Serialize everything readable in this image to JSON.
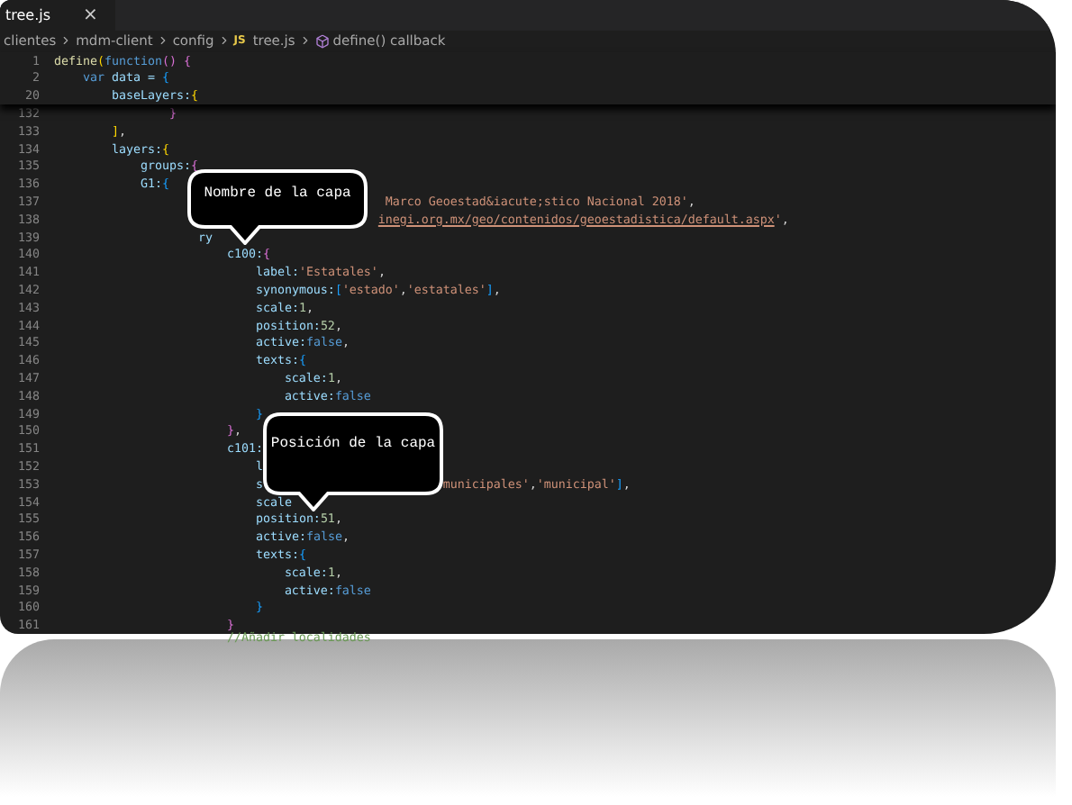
{
  "tab": {
    "label": "tree.js",
    "close": "×",
    "selected": true
  },
  "breadcrumb": [
    {
      "kind": "folder",
      "text": "clientes"
    },
    {
      "kind": "folder",
      "text": "mdm-client"
    },
    {
      "kind": "folder",
      "text": "config"
    },
    {
      "kind": "file",
      "badge": "JS",
      "text": "tree.js"
    },
    {
      "kind": "symbol",
      "text": "define() callback"
    }
  ],
  "sticky_lines": [
    {
      "number": "1",
      "tokens": [
        {
          "kind": "fn",
          "text": "define"
        },
        {
          "kind": "b1",
          "text": "("
        },
        {
          "kind": "kw",
          "text": "function"
        },
        {
          "kind": "b2",
          "text": "()"
        },
        {
          "kind": "b2",
          "text": " {"
        }
      ]
    },
    {
      "number": "2",
      "tokens": [
        {
          "kind": "kw",
          "text": "    var"
        },
        {
          "kind": "prop",
          "text": " data = "
        },
        {
          "kind": "b3",
          "text": "{"
        }
      ]
    },
    {
      "number": "20",
      "tokens": [
        {
          "kind": "prop",
          "text": "        baseLayers:"
        },
        {
          "kind": "b1",
          "text": "{"
        }
      ]
    }
  ],
  "lines": [
    {
      "number": "132",
      "tokens": [
        {
          "kind": "b2",
          "text": "                }"
        }
      ]
    },
    {
      "number": "133",
      "tokens": [
        {
          "kind": "b1",
          "text": "        ]"
        },
        {
          "kind": "punc",
          "text": ","
        }
      ]
    },
    {
      "number": "134",
      "tokens": [
        {
          "kind": "prop",
          "text": "        layers:"
        },
        {
          "kind": "b1",
          "text": "{"
        }
      ]
    },
    {
      "number": "135",
      "tokens": [
        {
          "kind": "prop",
          "text": "            groups:"
        },
        {
          "kind": "b2",
          "text": "{"
        }
      ]
    },
    {
      "number": "136",
      "tokens": [
        {
          "kind": "prop",
          "text": "            G1:"
        },
        {
          "kind": "b3",
          "text": "{"
        }
      ]
    },
    {
      "number": "137",
      "tokens": [
        {
          "kind": "str",
          "text": "                                              Marco Geoestad&iacute;stico Nacional 2018'"
        },
        {
          "kind": "punc",
          "text": ","
        }
      ]
    },
    {
      "number": "138",
      "tokens": [
        {
          "kind": "link",
          "text": "                                             inegi.org.mx/geo/contenidos/geoestadistica/default.aspx"
        },
        {
          "kind": "str",
          "text": "'"
        },
        {
          "kind": "punc",
          "text": ","
        }
      ]
    },
    {
      "number": "139",
      "tokens": [
        {
          "kind": "prop",
          "text": "                    ry"
        }
      ]
    },
    {
      "number": "140",
      "tokens": [
        {
          "kind": "prop",
          "text": "                        c100:"
        },
        {
          "kind": "b2",
          "text": "{"
        }
      ]
    },
    {
      "number": "141",
      "tokens": [
        {
          "kind": "prop",
          "text": "                            label:"
        },
        {
          "kind": "str",
          "text": "'Estatales'"
        },
        {
          "kind": "punc",
          "text": ","
        }
      ]
    },
    {
      "number": "142",
      "tokens": [
        {
          "kind": "prop",
          "text": "                            synonymous:"
        },
        {
          "kind": "b3",
          "text": "["
        },
        {
          "kind": "str",
          "text": "'estado'"
        },
        {
          "kind": "punc",
          "text": ","
        },
        {
          "kind": "str",
          "text": "'estatales'"
        },
        {
          "kind": "b3",
          "text": "]"
        },
        {
          "kind": "punc",
          "text": ","
        }
      ]
    },
    {
      "number": "143",
      "tokens": [
        {
          "kind": "prop",
          "text": "                            scale:"
        },
        {
          "kind": "num",
          "text": "1"
        },
        {
          "kind": "punc",
          "text": ","
        }
      ]
    },
    {
      "number": "144",
      "tokens": [
        {
          "kind": "prop",
          "text": "                            position:"
        },
        {
          "kind": "num",
          "text": "52"
        },
        {
          "kind": "punc",
          "text": ","
        }
      ]
    },
    {
      "number": "145",
      "tokens": [
        {
          "kind": "prop",
          "text": "                            active:"
        },
        {
          "kind": "kw",
          "text": "false"
        },
        {
          "kind": "punc",
          "text": ","
        }
      ]
    },
    {
      "number": "146",
      "tokens": [
        {
          "kind": "prop",
          "text": "                            texts:"
        },
        {
          "kind": "b3",
          "text": "{"
        }
      ]
    },
    {
      "number": "147",
      "tokens": [
        {
          "kind": "prop",
          "text": "                                scale:"
        },
        {
          "kind": "num",
          "text": "1"
        },
        {
          "kind": "punc",
          "text": ","
        }
      ]
    },
    {
      "number": "148",
      "tokens": [
        {
          "kind": "prop",
          "text": "                                active:"
        },
        {
          "kind": "kw",
          "text": "false"
        }
      ]
    },
    {
      "number": "149",
      "tokens": [
        {
          "kind": "b3",
          "text": "                            }"
        }
      ]
    },
    {
      "number": "150",
      "tokens": [
        {
          "kind": "b2",
          "text": "                        }"
        },
        {
          "kind": "punc",
          "text": ","
        }
      ]
    },
    {
      "number": "151",
      "tokens": [
        {
          "kind": "prop",
          "text": "                        c101:"
        }
      ]
    },
    {
      "number": "152",
      "tokens": [
        {
          "kind": "prop",
          "text": "                            l"
        }
      ]
    },
    {
      "number": "153",
      "tokens": [
        {
          "kind": "prop",
          "text": "                            s"
        },
        {
          "kind": "str",
          "text": "                         municipales'"
        },
        {
          "kind": "punc",
          "text": ","
        },
        {
          "kind": "str",
          "text": "'municipal'"
        },
        {
          "kind": "b3",
          "text": "]"
        },
        {
          "kind": "punc",
          "text": ","
        }
      ]
    },
    {
      "number": "154",
      "tokens": [
        {
          "kind": "prop",
          "text": "                            scale"
        }
      ]
    },
    {
      "number": "155",
      "tokens": [
        {
          "kind": "prop",
          "text": "                            position:"
        },
        {
          "kind": "num",
          "text": "51"
        },
        {
          "kind": "punc",
          "text": ","
        }
      ]
    },
    {
      "number": "156",
      "tokens": [
        {
          "kind": "prop",
          "text": "                            active:"
        },
        {
          "kind": "kw",
          "text": "false"
        },
        {
          "kind": "punc",
          "text": ","
        }
      ]
    },
    {
      "number": "157",
      "tokens": [
        {
          "kind": "prop",
          "text": "                            texts:"
        },
        {
          "kind": "b3",
          "text": "{"
        }
      ]
    },
    {
      "number": "158",
      "tokens": [
        {
          "kind": "prop",
          "text": "                                scale:"
        },
        {
          "kind": "num",
          "text": "1"
        },
        {
          "kind": "punc",
          "text": ","
        }
      ]
    },
    {
      "number": "159",
      "tokens": [
        {
          "kind": "prop",
          "text": "                                active:"
        },
        {
          "kind": "kw",
          "text": "false"
        }
      ]
    },
    {
      "number": "160",
      "tokens": [
        {
          "kind": "b3",
          "text": "                            }"
        }
      ]
    },
    {
      "number": "161",
      "tokens": [
        {
          "kind": "b2",
          "text": "                        }"
        }
      ]
    }
  ],
  "last_line": {
    "tokens": [
      {
        "kind": "comment",
        "text": "                        //Añadir localidades"
      }
    ]
  },
  "callouts": [
    {
      "text": "Nombre de la capa"
    },
    {
      "text": "Posición de la capa"
    }
  ]
}
